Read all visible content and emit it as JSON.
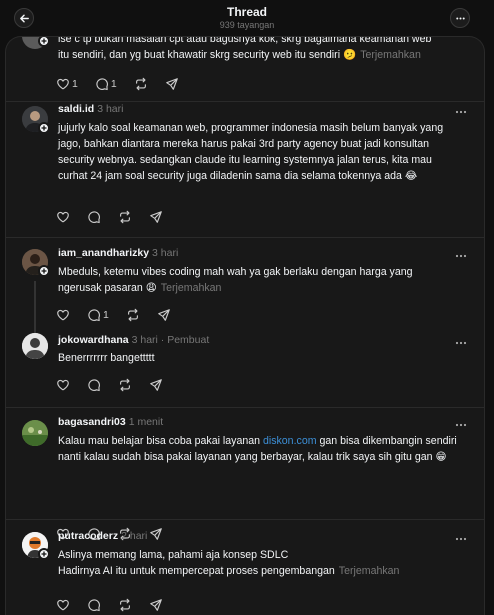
{
  "header": {
    "title": "Thread",
    "subtitle": "939 tayangan",
    "back_icon": "arrow-left-icon",
    "menu_icon": "more-horizontal-icon"
  },
  "ui": {
    "translate_label": "Terjemahkan",
    "accent_link": "#3d8fd6"
  },
  "posts": [
    {
      "text_line1": "ise c tp bukan masalah cpt atau bagusnya kok, skrg bagaimana keamanan web",
      "text_line2": "itu sendiri, dan yg buat khawatir skrg security web itu sendiri 🫤",
      "likes": "1",
      "replies": "1"
    },
    {
      "username": "saldi.id",
      "time": "3 hari",
      "text": "jujurly kalo soal keamanan web, programmer indonesia masih belum banyak yang jago, bahkan diantara mereka harus pakai 3rd party agency buat jadi konsultan security webnya. sedangkan claude itu learning systemnya jalan terus, kita mau curhat 24 jam soal security juga diladenin sama dia selama tokennya ada 😂"
    },
    {
      "username": "iam_anandharizky",
      "time": "3 hari",
      "text": "Mbeduls, ketemu vibes coding mah wah ya gak berlaku dengan harga yang ngerusak pasaran 😩",
      "replies": "1"
    },
    {
      "username": "jokowardhana",
      "time": "3 hari",
      "author_tag": "· Pembuat",
      "text": "Benerrrrrrr bangettttt"
    },
    {
      "username": "bagasandri03",
      "time": "1 menit",
      "text_before": "Kalau mau belajar bisa coba pakai layanan ",
      "link": "diskon.com",
      "text_after": " gan bisa dikembangin sendiri nanti kalau sudah bisa pakai layanan yang berbayar, kalau trik saya sih gitu gan 😁"
    },
    {
      "username": "putracoderz",
      "time": "2 hari",
      "text_line1": "Aslinya memang lama, pahami aja konsep SDLC",
      "text_line2": "Hadirnya AI itu untuk mempercepat proses pengembangan"
    }
  ]
}
